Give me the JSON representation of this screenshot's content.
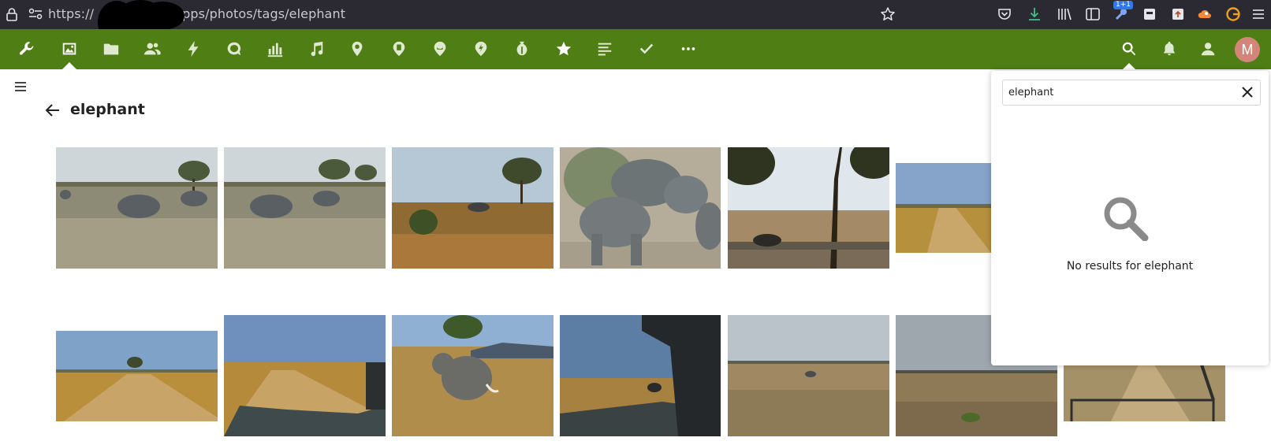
{
  "browser": {
    "url_visible_prefix": "https://",
    "url_visible_suffix": "pps/photos/tags/elephant",
    "extension_badge": "1+1"
  },
  "app": {
    "nav_icons": [
      "wrench-icon",
      "image-icon",
      "folder-icon",
      "contacts-icon",
      "activity-icon",
      "talk-icon",
      "chart-icon",
      "music-icon",
      "location-icon",
      "pin-icon",
      "pin-icon",
      "pin-icon",
      "money-icon",
      "star-icon",
      "text-icon",
      "check-icon",
      "more-icon"
    ],
    "active_nav": "image-icon",
    "avatar_initial": "M"
  },
  "page": {
    "title": "elephant"
  },
  "search": {
    "value": "elephant",
    "empty_message": "No results for elephant"
  },
  "colors": {
    "header_green": "#4f7e14",
    "browser_dark": "#2b2a33",
    "avatar": "#d4857a"
  }
}
